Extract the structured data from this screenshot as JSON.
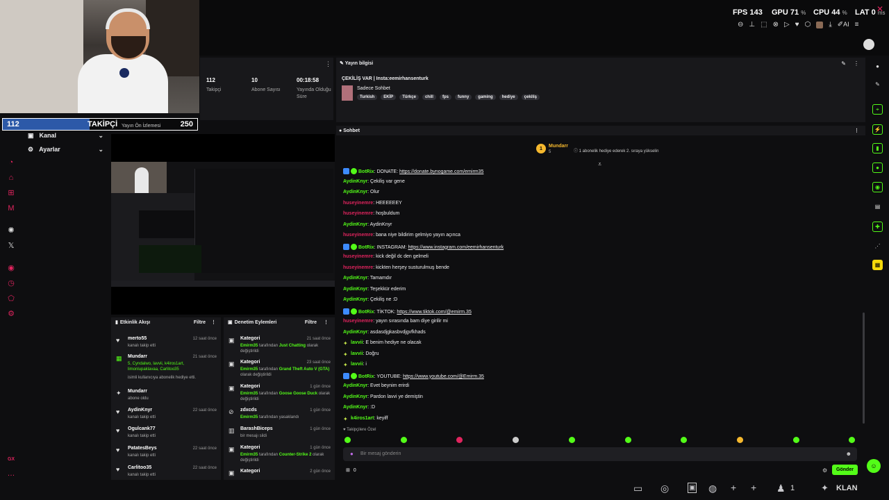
{
  "perf": {
    "fps_label": "FPS",
    "fps": "143",
    "gpu_label": "GPU",
    "gpu": "71",
    "cpu_label": "CPU",
    "cpu": "44",
    "lat_label": "LAT",
    "lat": "0",
    "pct": "%",
    "ms": "ms"
  },
  "toolbar": {
    "ai_label": "AI"
  },
  "follower_goal": {
    "current": "112",
    "label": "TAKİPÇİ",
    "max": "250",
    "progress": 0.448
  },
  "sidenav": {
    "preview_label": "Yayın Ön İzlemesi",
    "channel": "Kanal",
    "settings": "Ayarlar",
    "tag": "GX"
  },
  "stats": {
    "followers": "112",
    "followers_label": "Takipçi",
    "subs": "10",
    "subs_label": "Abone Sayısı",
    "uptime": "00:18:58",
    "uptime_label": "Yayında Olduğu Süre"
  },
  "stream_info": {
    "header": "Yayın bilgisi",
    "title": "ÇEKİLİŞ VAR | Insta:eemirhansenturk",
    "category": "Sadece Sohbet",
    "tags": [
      "Turkish",
      "EKİP",
      "Türkçe",
      "chill",
      "fps",
      "funny",
      "gaming",
      "hediye",
      "çekiliş"
    ]
  },
  "activity": {
    "header": "Etkinlik Akışı",
    "filter": "Filtre",
    "items": [
      {
        "name": "merto55",
        "sub": "kanalı takip etti",
        "time": "12 saat önce"
      },
      {
        "name": "Mundarr",
        "sub_green": "5, Cyndalwo, lavvii, k4iros1art, limonlupaklavaa, Carlitoo35",
        "sub": "isimli kullanıcıya abonelik hediye etti.",
        "time": "21 saat önce"
      },
      {
        "name": "Mundarr",
        "sub": "abone oldu",
        "time": ""
      },
      {
        "name": "AydinKnyr",
        "sub": "kanalı takip etti",
        "time": "22 saat önce"
      },
      {
        "name": "Ogulcank77",
        "sub": "kanalı takip etti",
        "time": ""
      },
      {
        "name": "PatatesBeys",
        "sub": "kanalı takip etti",
        "time": "22 saat önce"
      },
      {
        "name": "Carlitoo35",
        "sub": "kanalı takip etti",
        "time": "22 saat önce"
      }
    ]
  },
  "moderation": {
    "header": "Denetim Eylemleri",
    "filter": "Filtre",
    "items": [
      {
        "name": "Kategori",
        "actor": "Emirm35",
        "mid": "tarafından",
        "target": "Just Chatting",
        "end": "olarak değiştirildi",
        "time": "21 saat önce"
      },
      {
        "name": "Kategori",
        "actor": "Emirm35",
        "mid": "tarafından",
        "target": "Grand Theft Auto V (GTA)",
        "end": "olarak değiştirildi",
        "time": "23 saat önce"
      },
      {
        "name": "Kategori",
        "actor": "Emirm35",
        "mid": "tarafından",
        "target": "Goose Goose Duck",
        "end": "olarak değiştirildi",
        "time": "1 gün önce"
      },
      {
        "name": "zdxcds",
        "actor": "Emirm35",
        "mid": "tarafından yasaklandı",
        "target": "",
        "end": "",
        "time": "1 gün önce"
      },
      {
        "name": "BarashBiceps",
        "actor": "",
        "mid": "bir mesajı sildi",
        "target": "",
        "end": "",
        "time": "1 gün önce"
      },
      {
        "name": "Kategori",
        "actor": "Emirm35",
        "mid": "tarafından",
        "target": "Counter-Strike 2",
        "end": "olarak değiştirildi",
        "time": "1 gün önce"
      },
      {
        "name": "Kategori",
        "actor": "",
        "mid": "",
        "target": "",
        "end": "",
        "time": "2 gün önce"
      }
    ]
  },
  "chat": {
    "header": "Sohbet",
    "pinned_user": "Mundarr",
    "pinned_count": "5",
    "pinned_text": "1 abonelik hediye ederek 2. sıraya yükselin",
    "messages": [
      {
        "user": "BotRix",
        "color": "#53fc18",
        "bot": true,
        "text": "DONATE: ",
        "link": "https://donate.bynogame.com/emirm35"
      },
      {
        "user": "AydinKnyr",
        "color": "#53fc18",
        "text": "Çekiliş var gene"
      },
      {
        "user": "AydinKnyr",
        "color": "#53fc18",
        "text": "Olur"
      },
      {
        "user": "huseyinemre",
        "color": "#e0245e",
        "text": "HEEEEEEY"
      },
      {
        "user": "huseyinemre",
        "color": "#e0245e",
        "text": "hoşbuldum"
      },
      {
        "user": "AydinKnyr",
        "color": "#53fc18",
        "text": "AydinKnyr"
      },
      {
        "user": "huseyinemre",
        "color": "#e0245e",
        "text": "bana niye bildirim gelmiyo yayın açınca"
      },
      {
        "user": "BotRix",
        "color": "#53fc18",
        "bot": true,
        "text": "INSTAGRAM: ",
        "link": "https://www.instagram.com/eemirhansenturk"
      },
      {
        "user": "huseyinemre",
        "color": "#e0245e",
        "text": "kick değil dc den gelmeli"
      },
      {
        "user": "huseyinemre",
        "color": "#e0245e",
        "text": "kickten herşey susturulmuş bende"
      },
      {
        "user": "AydinKnyr",
        "color": "#53fc18",
        "text": "Tamamdır"
      },
      {
        "user": "AydinKnyr",
        "color": "#53fc18",
        "text": "Teşekkür ederim"
      },
      {
        "user": "AydinKnyr",
        "color": "#53fc18",
        "text": "Çekiliş ne :D"
      },
      {
        "user": "BotRix",
        "color": "#53fc18",
        "bot": true,
        "text": "TİKTOK: ",
        "link": "https://www.tiktok.com/@emirm.35"
      },
      {
        "user": "huseyinemre",
        "color": "#e0245e",
        "text": "yayın sırasında bam diye girilir mi"
      },
      {
        "user": "AydinKnyr",
        "color": "#53fc18",
        "text": "asdasdjgkasbvdjgvfkhads"
      },
      {
        "user": "lavvii",
        "color": "#53fc18",
        "sub": true,
        "text": "E benim hediye ne olacak"
      },
      {
        "user": "lavvii",
        "color": "#53fc18",
        "sub": true,
        "text": "Doğru"
      },
      {
        "user": "lavvii",
        "color": "#53fc18",
        "sub": true,
        "text": "i"
      },
      {
        "user": "BotRix",
        "color": "#53fc18",
        "bot": true,
        "text": "YOUTUBE: ",
        "link": "https://www.youtube.com/@Emirm.35"
      },
      {
        "user": "AydinKnyr",
        "color": "#53fc18",
        "text": "Evet beynim erirdi"
      },
      {
        "user": "AydinKnyr",
        "color": "#53fc18",
        "text": "Pardon lavvi ye demiştin"
      },
      {
        "user": "AydinKnyr",
        "color": "#53fc18",
        "text": ":D"
      },
      {
        "user": "k4iros1art",
        "color": "#53fc18",
        "sub": true,
        "text": "keyiff"
      }
    ],
    "followers_only": "Takipçilere Özel",
    "placeholder": "Bir mesaj gönderin",
    "count": "0",
    "send": "Gönder"
  },
  "taskbar": {
    "counter": "1",
    "clan": "KLAN"
  }
}
